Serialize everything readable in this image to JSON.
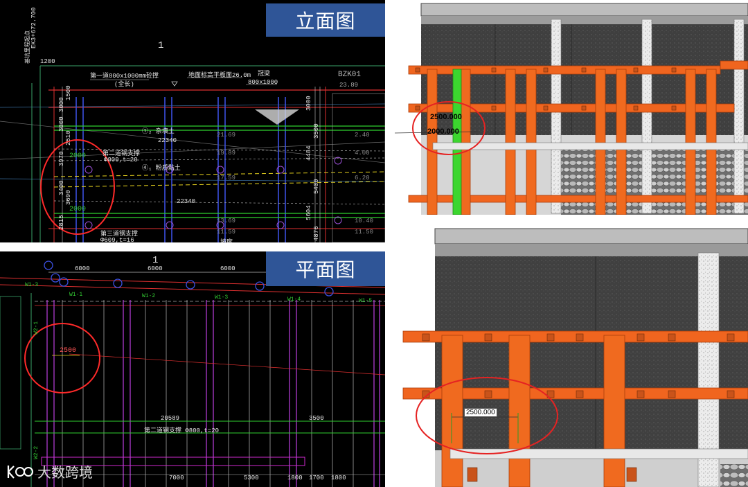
{
  "elevation": {
    "title": "立面图",
    "chainage": "EK3+672.700",
    "chainage_note": "基坑里程起点",
    "top_dim": "1200",
    "strut1": "第一道800x1000mm砼撑",
    "strut1_sub": "(全长)",
    "ground": "地面标高平板面26.0m",
    "crown_beam": "冠梁",
    "crown_size": "800x1000",
    "borehole": "BZK01",
    "borehole_level": "23.89",
    "strut2": "第二道钢支撑",
    "strut2_spec": "Φ800,t=20",
    "strut3": "第三道钢支撑",
    "strut3_spec": "Φ609,t=16",
    "span": "22340",
    "span2": "22340",
    "dims_left": [
      "3000",
      "1500",
      "3000",
      "2510",
      "3970",
      "3400",
      "3690",
      "2815"
    ],
    "dims_right": [
      "3000",
      "3500",
      "4484",
      "5400",
      "5604",
      "4876"
    ],
    "circle_dims": [
      "2000",
      "2000"
    ],
    "soil_labels": [
      "①₂ 杂填土",
      "④₁ 粉质黏土"
    ],
    "levels": [
      "21.69",
      "19.89",
      "17.59",
      "13.69",
      "11.59"
    ],
    "right_levels": [
      "2.40",
      "4.00",
      "6.20",
      "10.40",
      "11.50"
    ],
    "slope": "坡度",
    "axis": "1"
  },
  "plan": {
    "title": "平面图",
    "axis": "1",
    "top_dims": [
      "6000",
      "6000",
      "6000"
    ],
    "struts": [
      "W1-1",
      "W1-2",
      "W1-3",
      "W1-4",
      "W1-5"
    ],
    "left_tag": "W1-3",
    "circle_dim": "2500",
    "span": "20589",
    "right_dim": "3500",
    "strut_note": "第二道钢支撑 Φ800,t=20",
    "side_tags": [
      "W2-1",
      "W2-2"
    ],
    "bottom_dims": [
      "7000",
      "5300",
      "1800",
      "1700",
      "1800"
    ]
  },
  "model_top": {
    "dim1": "2500.000",
    "dim2": "2000.000"
  },
  "model_bottom": {
    "dim1": "2500.000"
  },
  "watermark": {
    "text": "大数跨境"
  }
}
